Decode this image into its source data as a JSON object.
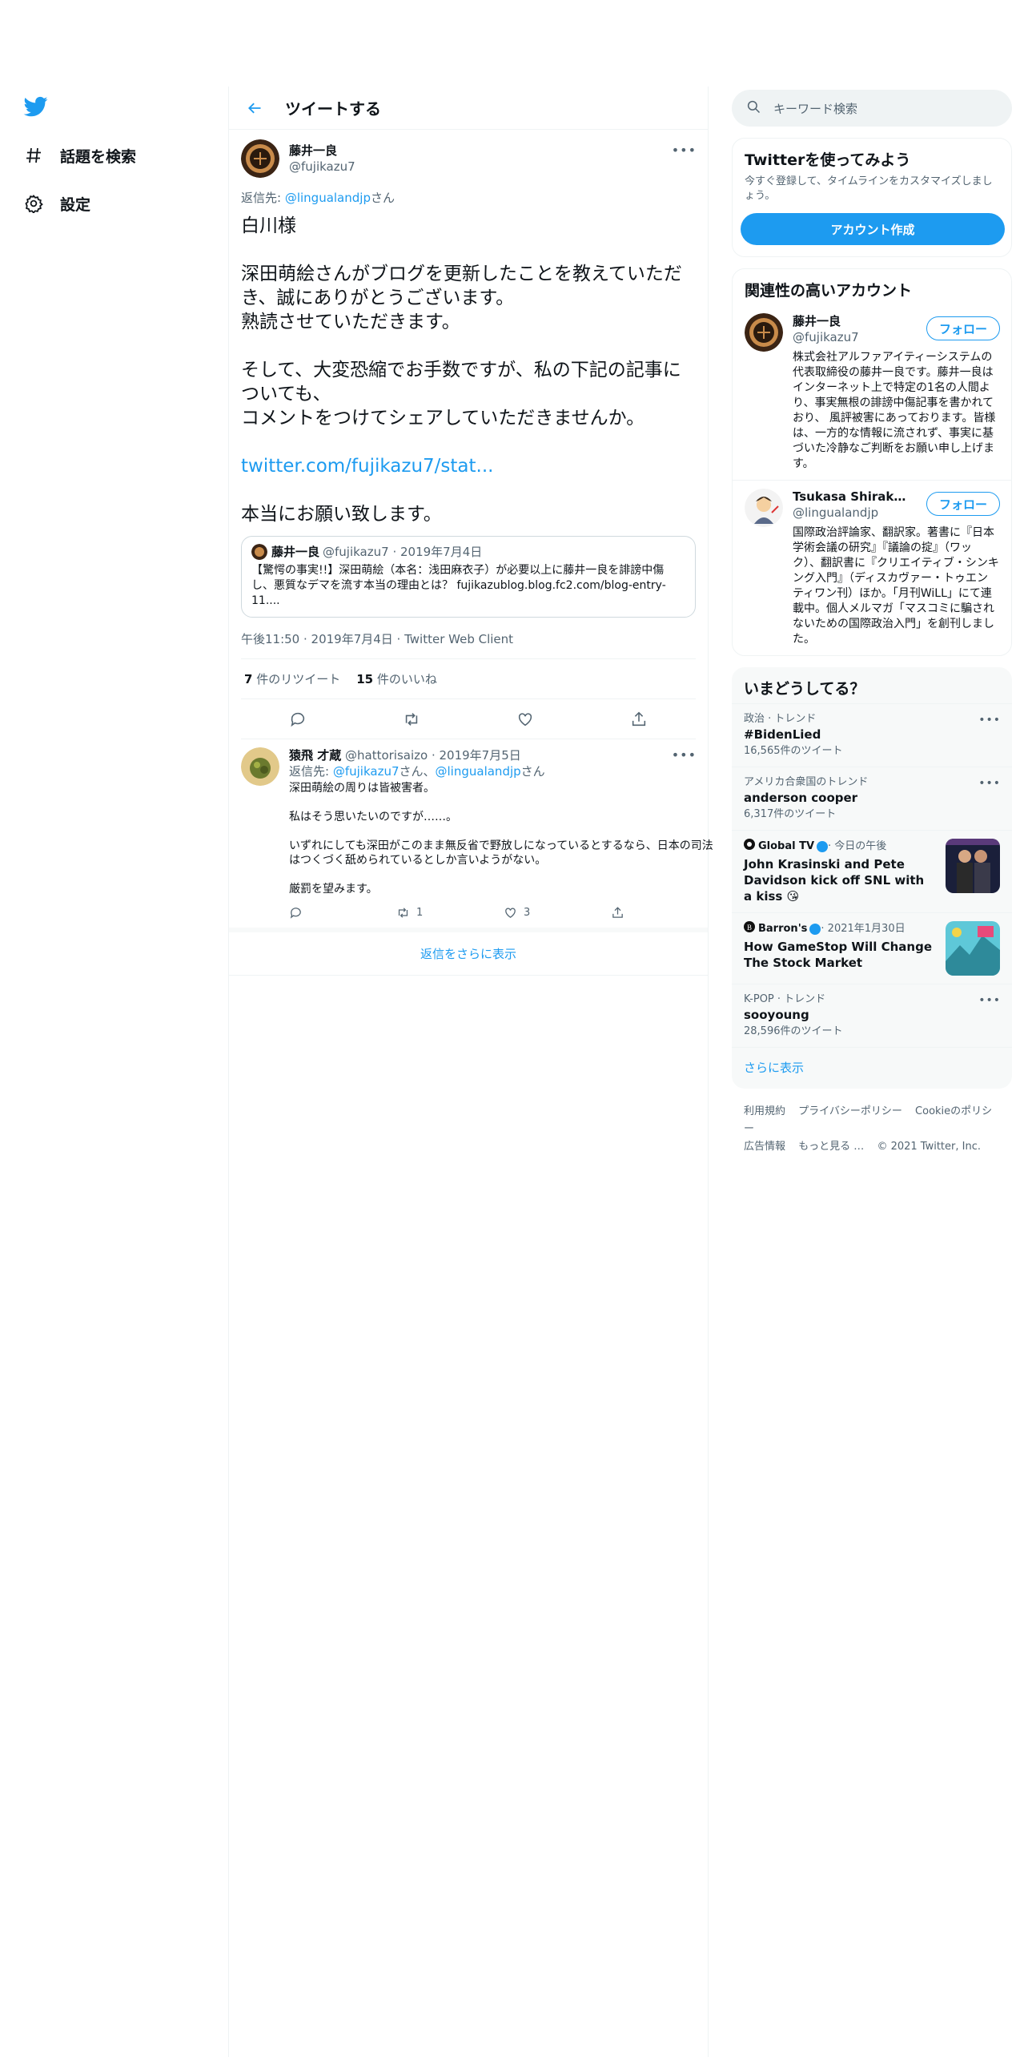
{
  "nav": {
    "items": [
      {
        "label": "話題を検索",
        "icon": "hashtag-icon"
      },
      {
        "label": "設定",
        "icon": "gear-icon"
      }
    ]
  },
  "header": {
    "title": "ツイートする"
  },
  "tweet": {
    "author_name": "藤井一良",
    "author_handle": "@fujikazu7",
    "reply_prefix": "返信先: ",
    "reply_to": "@lingualandjp",
    "reply_suffix": "さん",
    "text_before_link": "白川様\n\n深田萌絵さんがブログを更新したことを教えていただき、誠にありがとうございます。\n熟読させていただきます。\n\nそして、大変恐縮でお手数ですが、私の下記の記事についても、\nコメントをつけてシェアしていただきませんか。\n\n",
    "link": "twitter.com/fujikazu7/stat...",
    "text_after_link": "\n\n本当にお願い致します。",
    "quote": {
      "name": "藤井一良",
      "meta": "@fujikazu7 · 2019年7月4日",
      "text": "【驚愕の事実!!】深田萌絵（本名：浅田麻衣子）が必要以上に藤井一良を誹謗中傷し、悪質なデマを流す本当の理由とは？ fujikazublog.blog.fc2.com/blog-entry-11...."
    },
    "timestamp": "午後11:50 · 2019年7月4日 · Twitter Web Client",
    "retweets": "7",
    "retweets_label": " 件のリツイート",
    "likes": "15",
    "likes_label": " 件のいいね"
  },
  "reply": {
    "name": "猿飛 才蔵",
    "handle_date": " @hattorisaizo · 2019年7月5日",
    "reply_prefix": "返信先: ",
    "reply_to_1": "@fujikazu7",
    "reply_mid": "さん、",
    "reply_to_2": "@lingualandjp",
    "reply_suffix": "さん",
    "text": "深田萌絵の周りは皆被害者。\n\n私はそう思いたいのですが……。\n\nいずれにしても深田がこのまま無反省で野放しになっているとするなら、日本の司法はつくづく舐められているとしか言いようがない。\n\n厳罰を望みます。",
    "retweet_count": "1",
    "like_count": "3"
  },
  "show_more_replies": "返信をさらに表示",
  "search": {
    "placeholder": "キーワード検索"
  },
  "signup": {
    "title": "Twitterを使ってみよう",
    "desc": "今すぐ登録して、タイムラインをカスタマイズしましょう。",
    "button": "アカウント作成"
  },
  "related": {
    "title": "関連性の高いアカウント",
    "follow_label": "フォロー",
    "accounts": [
      {
        "name": "藤井一良",
        "handle": "@fujikazu7",
        "bio": "株式会社アルファアイティーシステムの代表取締役の藤井一良です。藤井一良はインターネット上で特定の1名の人間より、事実無根の誹謗中傷記事を書かれており、 風評被害にあっております。皆様は、一方的な情報に流されず、事実に基づいた冷静なご判断をお願い申し上げます。"
      },
      {
        "name": "Tsukasa Shirakawa（白川司）",
        "handle": "@lingualandjp",
        "bio": "国際政治評論家、翻訳家。著書に『日本学術会議の研究』『議論の掟』（ワック）、翻訳書に『クリエイティブ・シンキング入門』（ディスカヴァー・トゥエンティワン刊）ほか。「月刊WiLL」にて連載中。個人メルマガ「マスコミに騙されないための国際政治入門」を創刊しました。"
      }
    ]
  },
  "trends": {
    "title": "いまどうしてる？",
    "items": [
      {
        "context": "政治 · トレンド",
        "name": "#BidenLied",
        "count": "16,565件のツイート"
      },
      {
        "context": "アメリカ合衆国のトレンド",
        "name": "anderson cooper",
        "count": "6,317件のツイート"
      }
    ],
    "news": [
      {
        "source": "Global TV",
        "time": " · 今日の午後",
        "headline": "John Krasinski and Pete Davidson kick off SNL with a kiss 😘"
      },
      {
        "source": "Barron's",
        "time": " · 2021年1月30日",
        "headline": "How GameStop Will Change The Stock Market"
      }
    ],
    "last": {
      "context": "K-POP · トレンド",
      "name": "sooyoung",
      "count": "28,596件のツイート"
    },
    "show_more": "さらに表示"
  },
  "footer": {
    "links": [
      "利用規約",
      "プライバシーポリシー",
      "Cookieのポリシー",
      "広告情報",
      "もっと見る …",
      "© 2021 Twitter, Inc."
    ]
  },
  "colors": {
    "accent": "#1d9bf0",
    "secondary_text": "#536471",
    "border": "#eff3f4"
  }
}
